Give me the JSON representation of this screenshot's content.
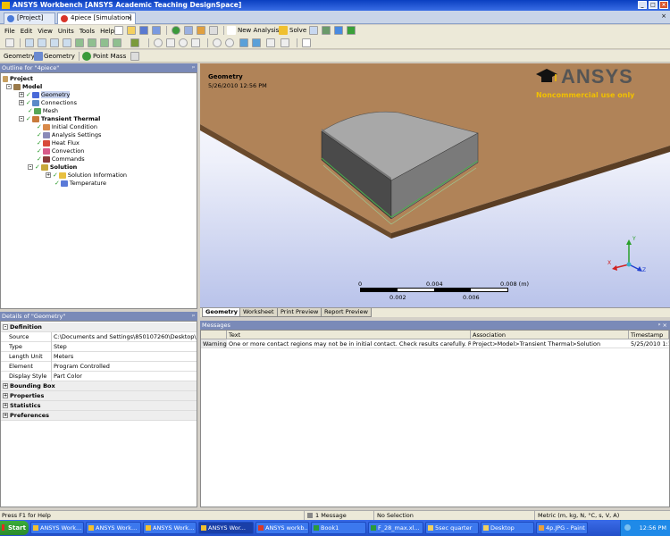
{
  "window": {
    "title": "ANSYS Workbench [ANSYS Academic Teaching DesignSpace]"
  },
  "tabs": [
    {
      "label": "[Project]"
    },
    {
      "label": "4piece [Simulation]"
    }
  ],
  "menu": [
    "File",
    "Edit",
    "View",
    "Units",
    "Tools",
    "Help"
  ],
  "toolbar": {
    "new_analysis": "New Analysis",
    "solve": "Solve",
    "geometry_btn1": "Geometry",
    "geometry_btn2": "Geometry",
    "point_mass": "Point Mass"
  },
  "outline": {
    "header": "Outline for \"4piece\"",
    "items": [
      {
        "label": "Project"
      },
      {
        "label": "Model"
      },
      {
        "label": "Geometry"
      },
      {
        "label": "Connections"
      },
      {
        "label": "Mesh"
      },
      {
        "label": "Transient Thermal"
      },
      {
        "label": "Initial Condition"
      },
      {
        "label": "Analysis Settings"
      },
      {
        "label": "Heat Flux"
      },
      {
        "label": "Convection"
      },
      {
        "label": "Commands"
      },
      {
        "label": "Solution"
      },
      {
        "label": "Solution Information"
      },
      {
        "label": "Temperature"
      }
    ]
  },
  "details": {
    "header": "Details of \"Geometry\"",
    "definition": "Definition",
    "rows": [
      {
        "k": "Source",
        "v": "C:\\Documents and Settings\\850107260\\Desktop\\Desk..."
      },
      {
        "k": "Type",
        "v": "Step"
      },
      {
        "k": "Length Unit",
        "v": "Meters"
      },
      {
        "k": "Element Control",
        "v": "Program Controlled"
      },
      {
        "k": "Display Style",
        "v": "Part Color"
      }
    ],
    "sections": [
      "Bounding Box",
      "Properties",
      "Statistics",
      "Preferences"
    ]
  },
  "viewport": {
    "title": "Geometry",
    "date": "5/26/2010 12:56 PM",
    "logo": "ANSYS",
    "logo_sub": "Noncommercial use only",
    "scale_ticks_top": [
      "0",
      "0.004",
      "0.008 (m)"
    ],
    "scale_ticks_bottom": [
      "0.002",
      "0.006"
    ],
    "axis": {
      "x": "X",
      "y": "Y",
      "z": "Z"
    }
  },
  "view_tabs": [
    "Geometry",
    "Worksheet",
    "Print Preview",
    "Report Preview"
  ],
  "messages": {
    "header": "Messages",
    "columns": [
      "Text",
      "Association",
      "Timestamp"
    ],
    "row": {
      "type": "Warning",
      "text": "One or more contact regions may not be in initial contact.  Check results carefully.  Refer to Tro",
      "association": "Project>Model>Transient Thermal>Solution",
      "timestamp": "5/25/2010 1:10"
    }
  },
  "status": {
    "help": "Press F1 for Help",
    "messages": "1 Message",
    "selection": "No Selection",
    "units": "Metric (m, kg, N, °C, s, V, A)"
  },
  "taskbar": {
    "start": "Start",
    "tasks": [
      "ANSYS Work...",
      "ANSYS Work...",
      "ANSYS Work...",
      "ANSYS Wor...",
      "ANSYS workb...",
      "Book1",
      "F_28_max.xl...",
      "5sec quarter",
      "Desktop",
      "4p.JPG - Paint"
    ],
    "clock": "12:56 PM"
  }
}
